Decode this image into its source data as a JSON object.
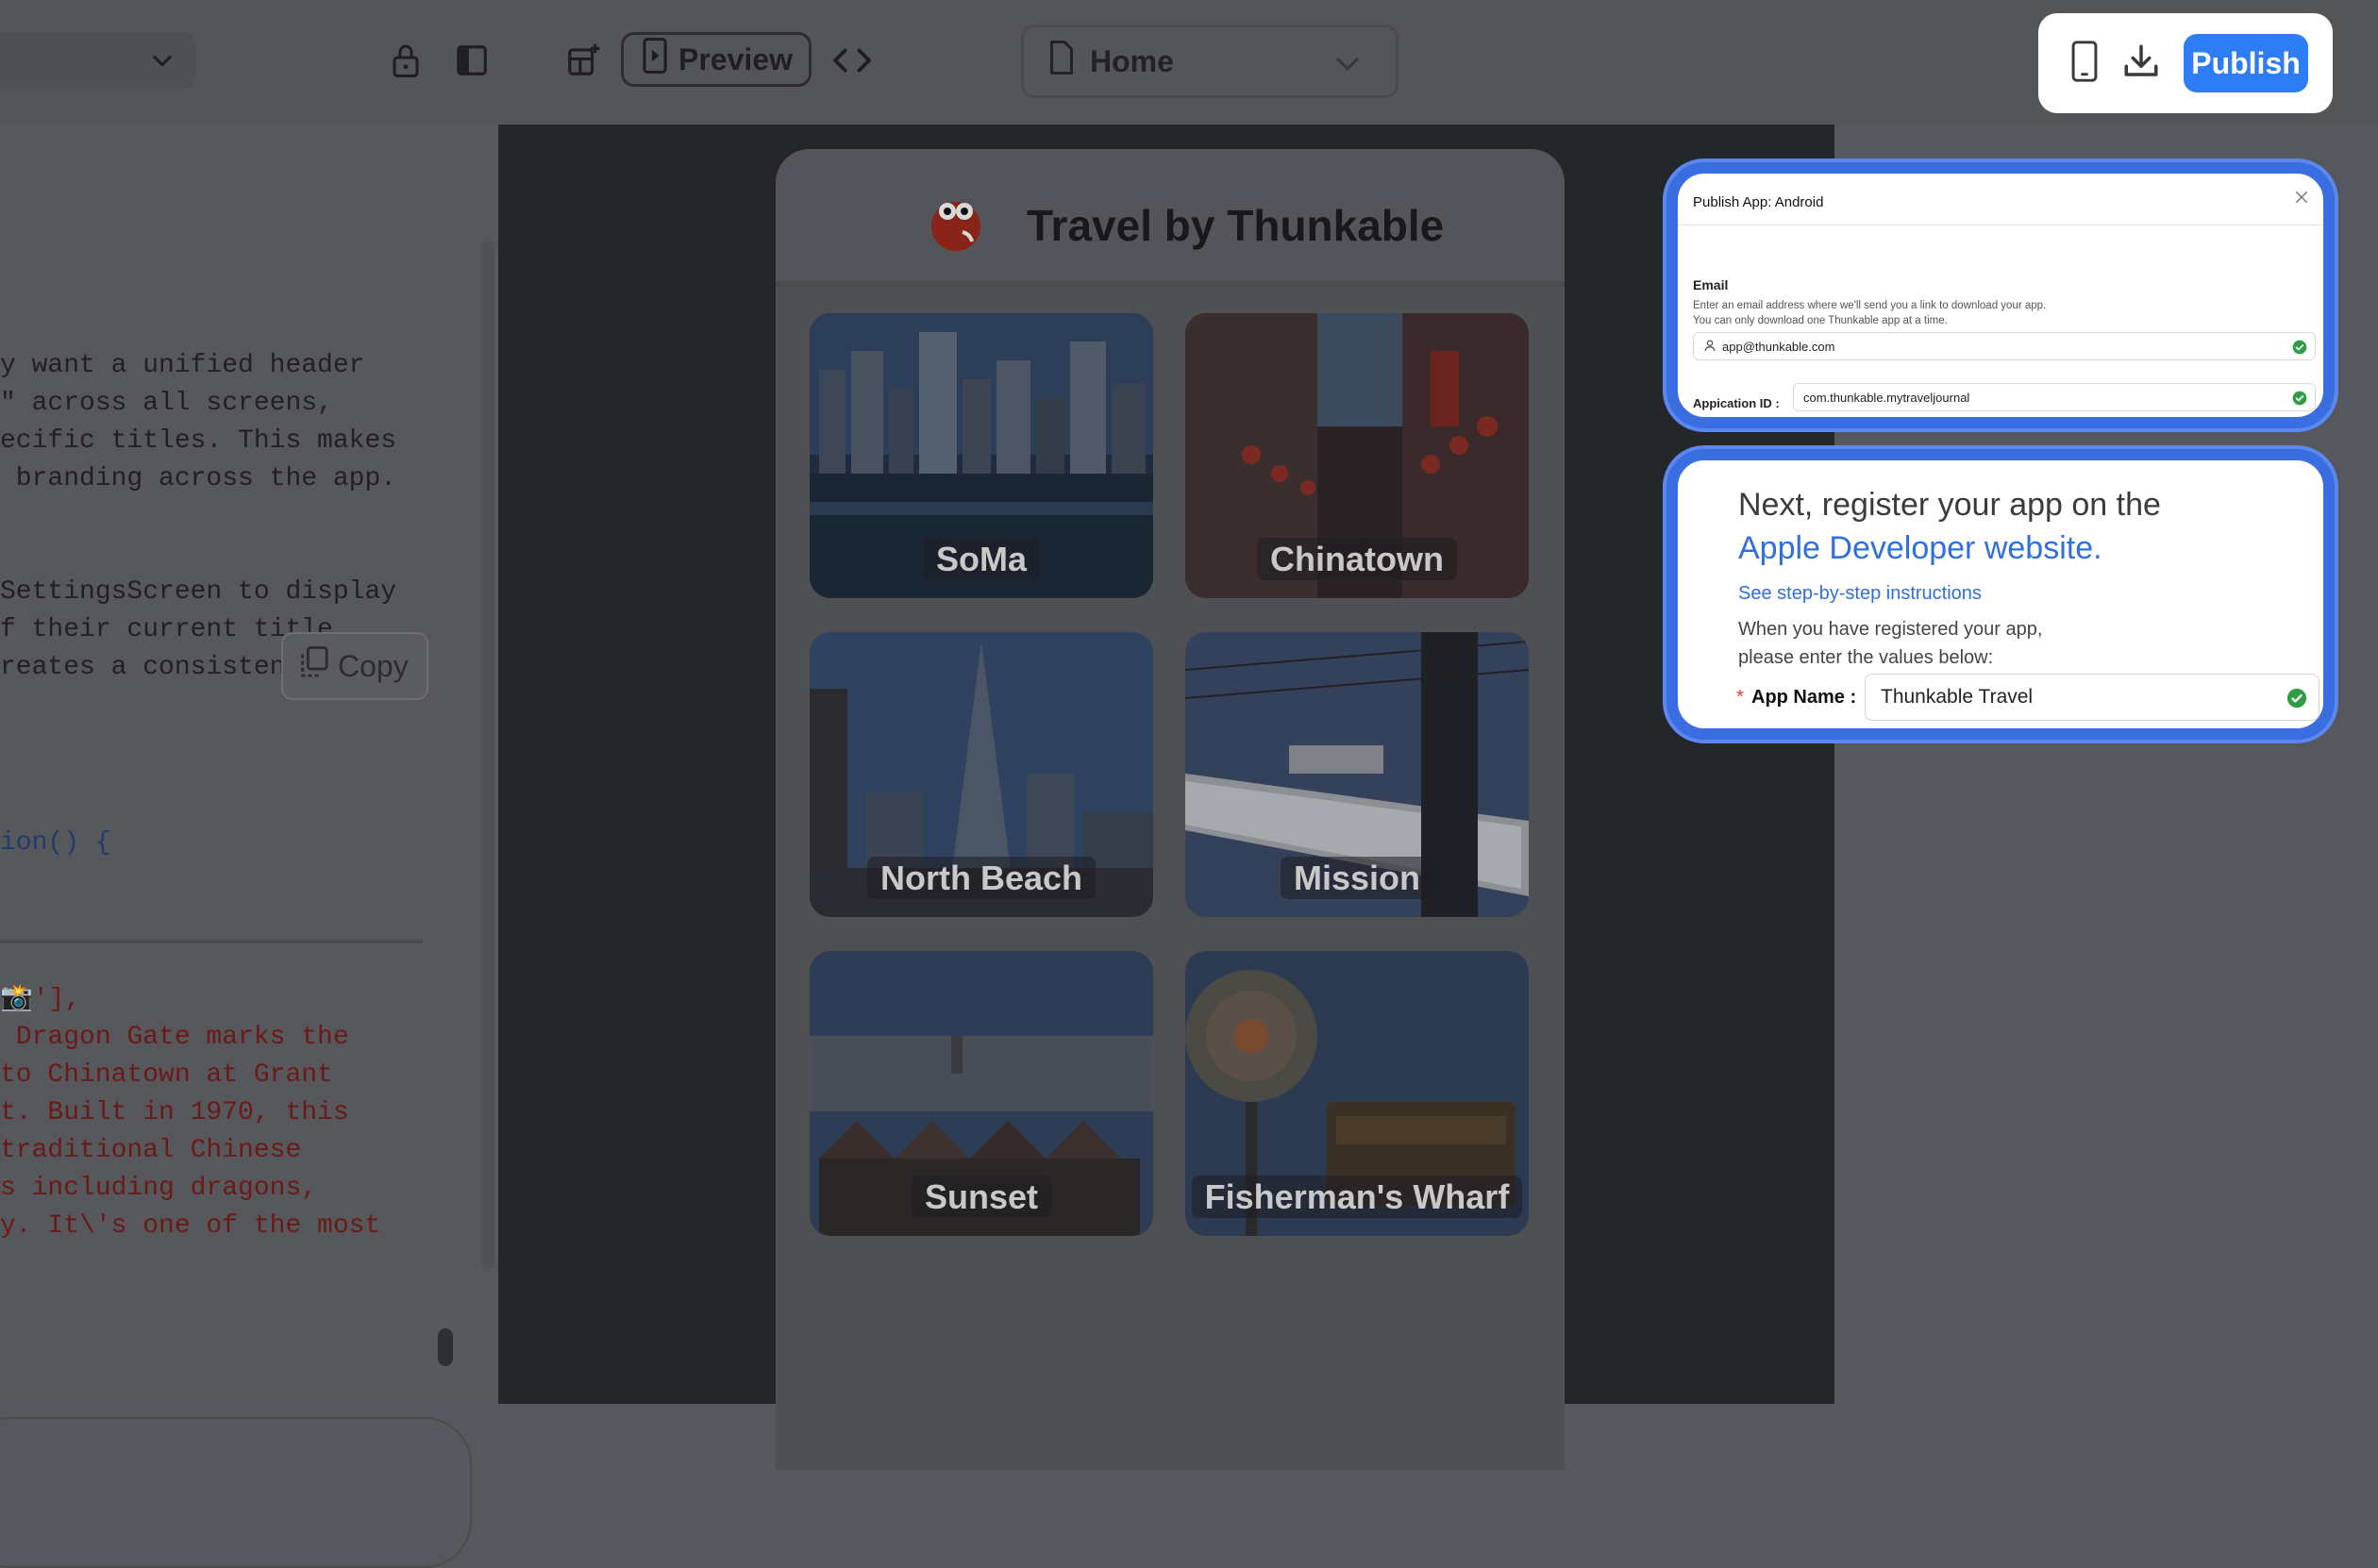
{
  "toolbar": {
    "preview_label": "Preview",
    "screen_select_value": "Home",
    "publish_label": "Publish"
  },
  "code_panel": {
    "lines_top": [
      "y want a unified header",
      "\" across all screens,",
      "ecific titles. This makes",
      " branding across the app."
    ],
    "lines_mid": [
      "SettingsScreen to display",
      "f their current title",
      "reates a consistent"
    ],
    "function_line": "ion() {",
    "lines_bottom": [
      "📸'],",
      " Dragon Gate marks the",
      "to Chinatown at Grant",
      "t. Built in 1970, this",
      "traditional Chinese",
      "s including dragons,",
      "y. It\\'s one of the most"
    ],
    "copy_label": "Copy"
  },
  "phone": {
    "title": "Travel by Thunkable",
    "tiles": [
      {
        "label": "SoMa",
        "icon": "city-skyline-photo"
      },
      {
        "label": "Chinatown",
        "icon": "lanterns-street-photo"
      },
      {
        "label": "North Beach",
        "icon": "transamerica-tower-photo"
      },
      {
        "label": "Mission",
        "icon": "mission-street-sign-photo"
      },
      {
        "label": "Sunset",
        "icon": "painted-ladies-photo"
      },
      {
        "label": "Fisherman's Wharf",
        "icon": "wharf-sign-photo"
      }
    ]
  },
  "android_dialog": {
    "title": "Publish App: Android",
    "email_label": "Email",
    "help_line1": "Enter an email address where we'll send you a link to download your app.",
    "help_line2": "You can only download one Thunkable app at a time.",
    "email_value": "app@thunkable.com",
    "appid_label": "Appication ID :",
    "appid_value": "com.thunkable.mytraveljournal"
  },
  "apple_card": {
    "heading_line1": "Next, register your app on the",
    "heading_link": "Apple Developer website.",
    "steps_link": "See step-by-step instructions",
    "desc_line1": "When you have registered your app,",
    "desc_line2": "please enter the values below:",
    "required_mark": "*",
    "app_name_label": "App Name :",
    "app_name_value": "Thunkable Travel"
  },
  "colors": {
    "accent": "#2f7df4",
    "highlight_border": "#3a6ee0",
    "success": "#2e9e44",
    "overlay_bg": "#56585d"
  }
}
